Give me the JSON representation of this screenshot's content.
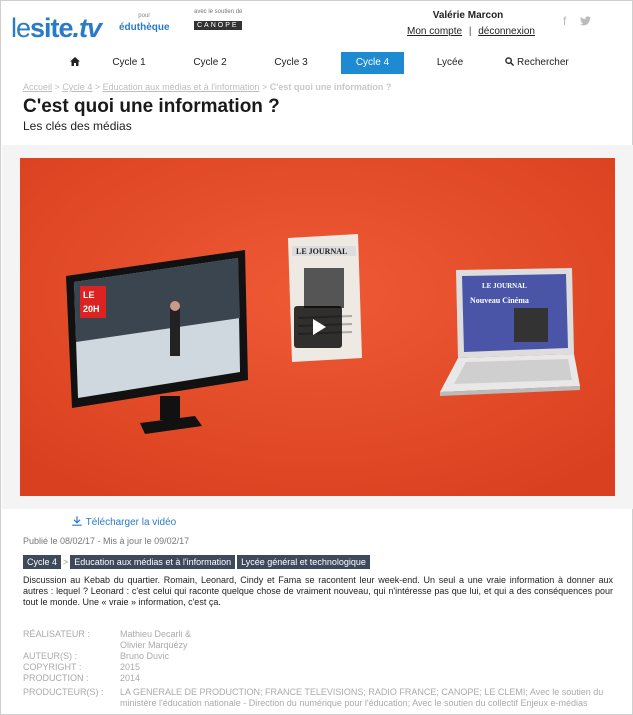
{
  "header": {
    "logo_le": "le",
    "logo_site": "site",
    "logo_tv": ".tv",
    "edutheque_small": "pour",
    "edutheque_label": "éduthèque",
    "canope_caption": "avec le soutien de",
    "canope_label": "CANOPE",
    "user_name": "Valérie Marcon",
    "account_link": "Mon compte",
    "separator": "|",
    "logout_link": "déconnexion",
    "social_facebook": "f",
    "social_twitter": "𝕥"
  },
  "nav": {
    "home_icon": "🏠",
    "items": [
      "Cycle 1",
      "Cycle 2",
      "Cycle 3",
      "Cycle 4",
      "Lycée"
    ],
    "search_label": "Rechercher",
    "active_index": 3
  },
  "breadcrumb": {
    "home": "Accueil",
    "sep": ">",
    "cycle": "Cycle 4",
    "topic": "Education aux médias et à l'information",
    "current": "C'est quoi une information ?"
  },
  "page": {
    "title": "C'est quoi une information ?",
    "subtitle": "Les clés des médias"
  },
  "video": {
    "tv_label_le": "LE",
    "tv_label_20h": "20H",
    "newspaper_title": "LE JOURNAL",
    "laptop_title": "LE JOURNAL",
    "laptop_subtitle": "Nouveau Cinéma"
  },
  "download_label": "Télécharger la vidéo",
  "dates": "Publié le 08/02/17 - Mis à jour le 09/02/17",
  "tags": {
    "cycle": "Cycle 4",
    "sep": ">",
    "topic": "Education aux médias et à l'information",
    "level": "Lycée général et technologique"
  },
  "description": "Discussion au Kebab du quartier. Romain, Leonard, Cindy et Fama se racontent leur week-end. Un seul a une vraie information à donner aux autres : lequel ? Leonard : c'est celui qui raconte quelque chose de vraiment nouveau, qui n'intéresse pas que lui, et qui a des conséquences pour tout le monde. Une « vraie » information, c'est ça.",
  "meta": {
    "realisateur_key": "RÉALISATEUR :",
    "realisateur_val1": "Mathieu Decarli &",
    "realisateur_val2": "Olivier Marquézy",
    "auteurs_key": "AUTEUR(S) :",
    "auteurs_val": "Bruno Duvic",
    "copyright_key": "COPYRIGHT :",
    "copyright_val": "2015",
    "production_key": "PRODUCTION :",
    "production_val": "2014",
    "producteurs_key": "PRODUCTEUR(S) :",
    "producteurs_val": "LA GENERALE DE PRODUCTION; FRANCE TELEVISIONS; RADIO FRANCE; CANOPE; LE CLEMI; Avec le soutien du ministère l'éducation nationale - Direction du numérique pour l'éducation; Avec le soutien du collectif Enjeux e-médias"
  },
  "colors": {
    "accent": "#1e8ad2",
    "video_bg": "#e84a2a",
    "tag_bg": "#3e4a5c"
  }
}
